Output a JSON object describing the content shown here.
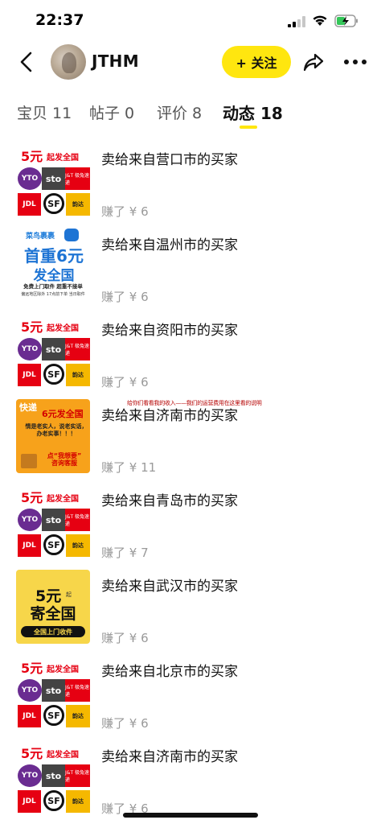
{
  "status_bar": {
    "time": "22:37"
  },
  "header": {
    "username": "JTHM",
    "follow_label": "+ 关注"
  },
  "tabs": [
    {
      "label": "宝贝 11",
      "active": false
    },
    {
      "label": "帖子 0",
      "active": false
    },
    {
      "label": "评价 8",
      "active": false
    },
    {
      "label": "动态 18",
      "active": true
    }
  ],
  "thumb_a": {
    "price": "5元",
    "slogan": "起发全国",
    "yto": "YTO",
    "sto": "sto",
    "jt": "J&T 极兔速递",
    "jdl": "JDL",
    "sf": "SF",
    "yd": "韵达"
  },
  "thumb_b": {
    "top": "菜鸟裹裹",
    "line1": "首重6元",
    "line2": "发全国",
    "note": "免费上门取件 超重不接单",
    "note2": "偏远地区除外 17点前下单 当日取件"
  },
  "thumb_c": {
    "line1": "快递",
    "line2": "6元发全国",
    "line3": "情是老实人，说老实话，\n办老实事！！！",
    "line4": "点“我想要”\n咨询客服"
  },
  "thumb_d": {
    "line1": "5元",
    "line1_small": "起",
    "line2": "寄全国",
    "line3": "全国上门收件"
  },
  "items": [
    {
      "title": "卖给来自营口市的买家",
      "earn": "赚了 ¥ 6"
    },
    {
      "title": "卖给来自温州市的买家",
      "earn": "赚了 ¥ 6"
    },
    {
      "title": "卖给来自资阳市的买家",
      "earn": "赚了 ¥ 6"
    },
    {
      "title": "卖给来自济南市的买家",
      "earn": "赚了 ¥ 11",
      "overlay": "给你们看看我的收入——我们的运营费用在这里看的说明"
    },
    {
      "title": "卖给来自青岛市的买家",
      "earn": "赚了 ¥ 7"
    },
    {
      "title": "卖给来自武汉市的买家",
      "earn": "赚了 ¥ 6"
    },
    {
      "title": "卖给来自北京市的买家",
      "earn": "赚了 ¥ 6"
    },
    {
      "title": "卖给来自济南市的买家",
      "earn": "赚了 ¥ 6"
    }
  ]
}
